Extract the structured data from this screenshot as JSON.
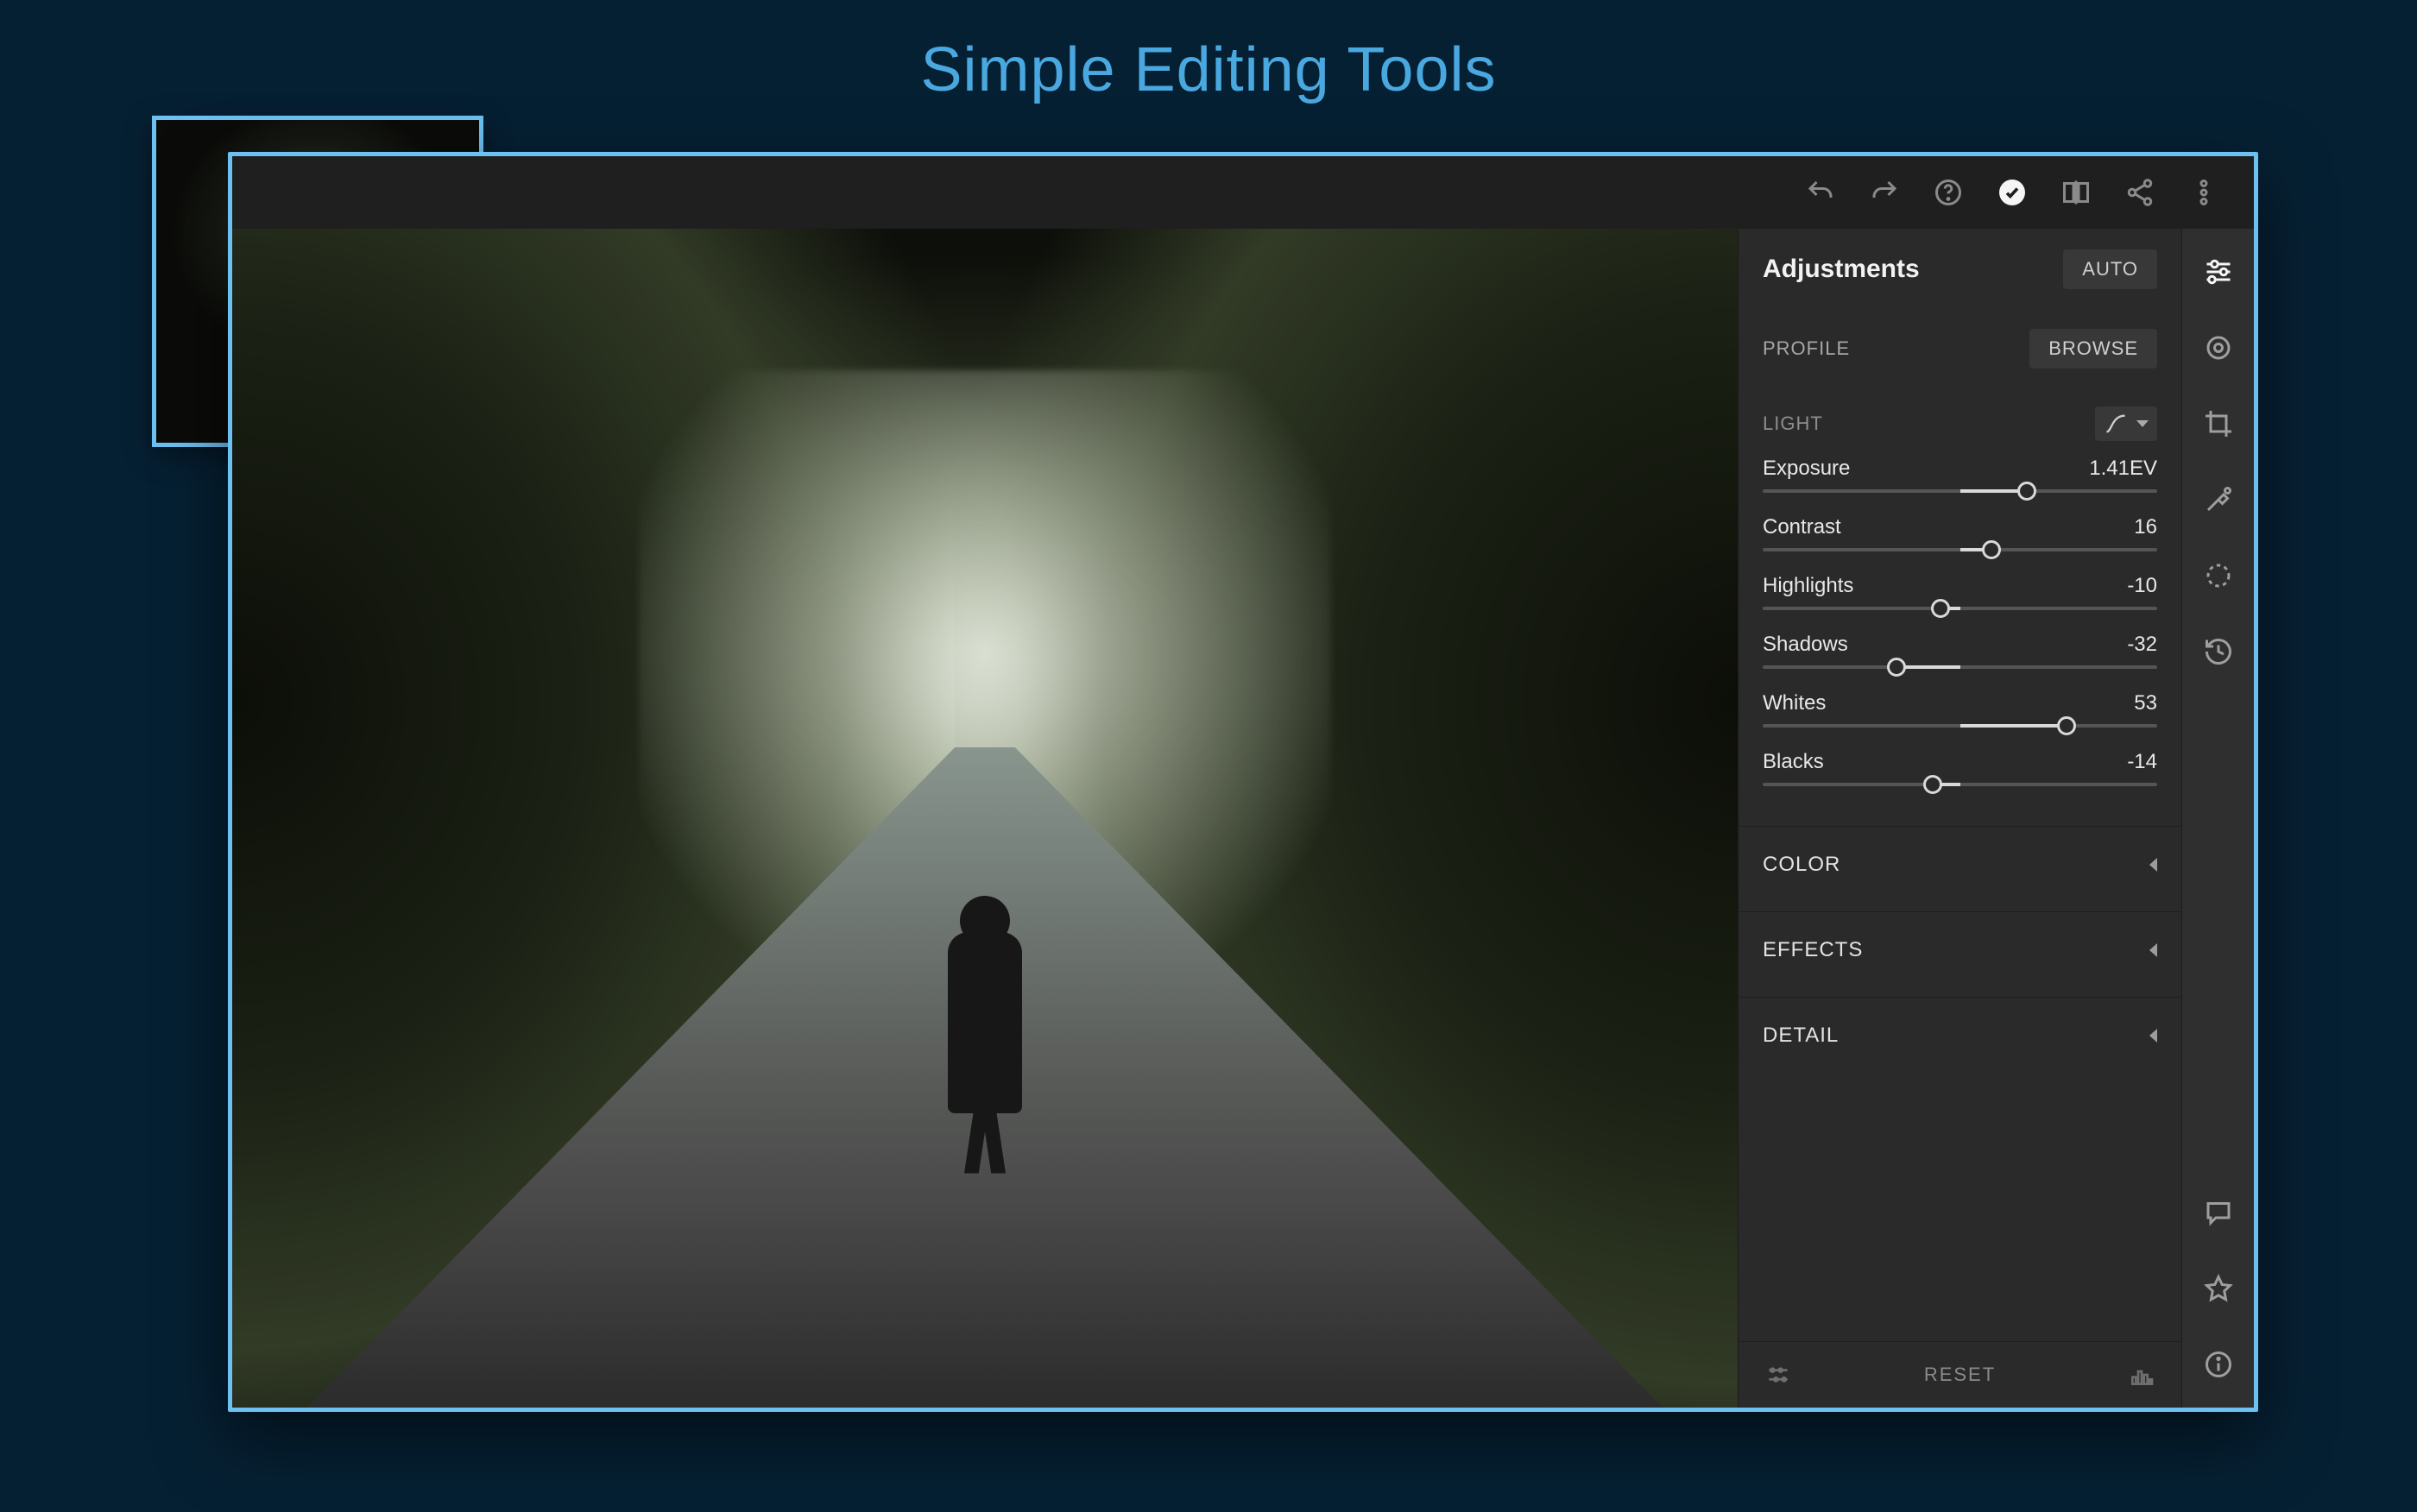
{
  "page": {
    "title": "Simple Editing Tools"
  },
  "panel": {
    "header": "Adjustments",
    "auto_button": "AUTO",
    "profile_label": "PROFILE",
    "browse_button": "BROWSE",
    "light_label": "LIGHT",
    "sliders": [
      {
        "name": "Exposure",
        "value_label": "1.41EV",
        "pos": 67,
        "dir": "pos"
      },
      {
        "name": "Contrast",
        "value_label": "16",
        "pos": 58,
        "dir": "pos"
      },
      {
        "name": "Highlights",
        "value_label": "-10",
        "pos": 45,
        "dir": "neg"
      },
      {
        "name": "Shadows",
        "value_label": "-32",
        "pos": 34,
        "dir": "neg"
      },
      {
        "name": "Whites",
        "value_label": "53",
        "pos": 77,
        "dir": "pos"
      },
      {
        "name": "Blacks",
        "value_label": "-14",
        "pos": 43,
        "dir": "neg"
      }
    ],
    "sections": [
      {
        "label": "COLOR"
      },
      {
        "label": "EFFECTS"
      },
      {
        "label": "DETAIL"
      }
    ],
    "reset_label": "RESET"
  }
}
